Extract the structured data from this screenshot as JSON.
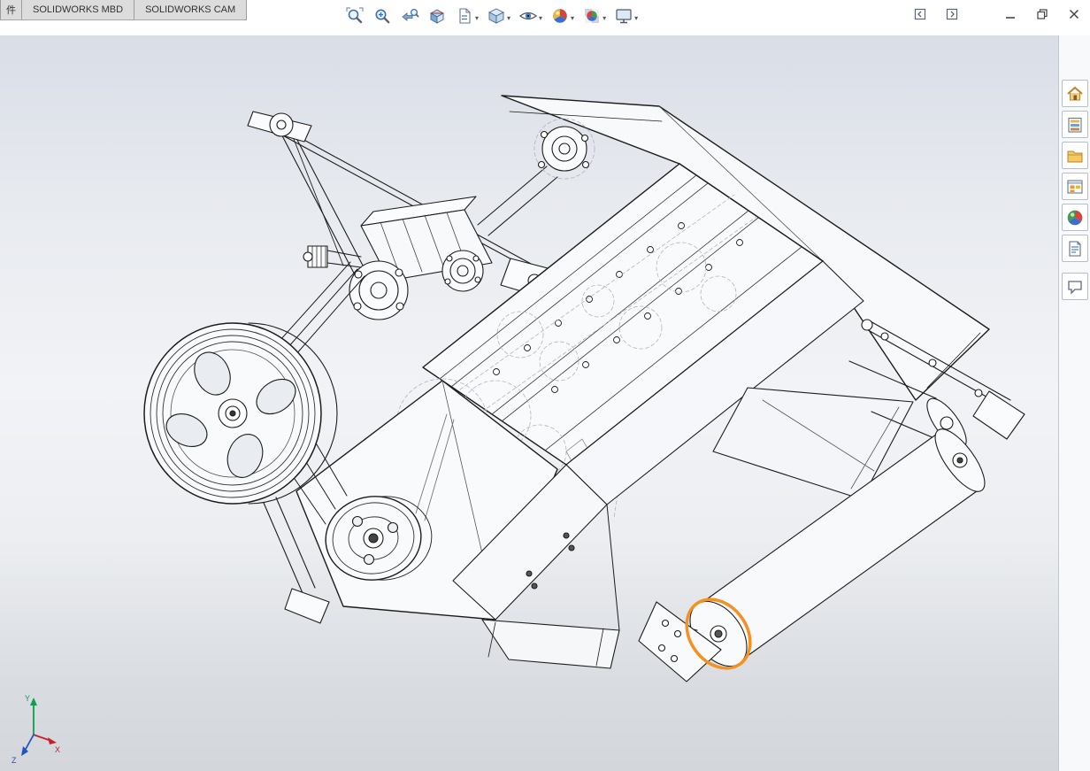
{
  "window": {
    "tabs": [
      {
        "label": "件"
      },
      {
        "label": "SOLIDWORKS MBD"
      },
      {
        "label": "SOLIDWORKS CAM"
      }
    ],
    "controls": {
      "panel_buttons": [
        "collapse-pane-left",
        "collapse-pane-right"
      ],
      "minimize": "minimize",
      "restore": "restore-down",
      "close": "close"
    }
  },
  "heads_up_toolbar": {
    "items": [
      {
        "name": "zoom-to-fit",
        "icon": "magnifier-icon",
        "has_dropdown": false
      },
      {
        "name": "zoom-to-area",
        "icon": "magnifier-plus-icon",
        "has_dropdown": false
      },
      {
        "name": "previous-view",
        "icon": "back-arrow-magnifier-icon",
        "has_dropdown": false
      },
      {
        "name": "section-view",
        "icon": "section-cube-icon",
        "has_dropdown": false
      },
      {
        "name": "dynamic-annotation-views",
        "icon": "annotation-page-icon",
        "has_dropdown": true
      },
      {
        "name": "view-orientation",
        "icon": "cube-icon",
        "has_dropdown": true
      },
      {
        "name": "hide-show-items",
        "icon": "eye-icon",
        "has_dropdown": true
      },
      {
        "name": "edit-appearance",
        "icon": "appearance-ball-icon",
        "has_dropdown": true
      },
      {
        "name": "apply-scene",
        "icon": "scene-ball-icon",
        "has_dropdown": true
      },
      {
        "name": "view-settings",
        "icon": "monitor-icon",
        "has_dropdown": true
      }
    ]
  },
  "task_pane": {
    "items": [
      {
        "name": "solidworks-resources",
        "icon": "home-icon"
      },
      {
        "name": "design-library",
        "icon": "library-icon"
      },
      {
        "name": "file-explorer",
        "icon": "folder-icon"
      },
      {
        "name": "view-palette",
        "icon": "palette-window-icon"
      },
      {
        "name": "appearances-scenes",
        "icon": "appearance-sphere-icon"
      },
      {
        "name": "custom-properties",
        "icon": "document-properties-icon"
      },
      {
        "name": "solidworks-forum",
        "icon": "comment-bubble-icon"
      }
    ]
  },
  "viewport": {
    "content": "wireframe assembly of a belt-driven roller machine",
    "selection_color": "#F59120",
    "triad": {
      "x_label": "X",
      "y_label": "Y",
      "z_label": "Z",
      "x_color": "#c8202a",
      "y_color": "#0f9d4e",
      "z_color": "#2053c8"
    }
  }
}
